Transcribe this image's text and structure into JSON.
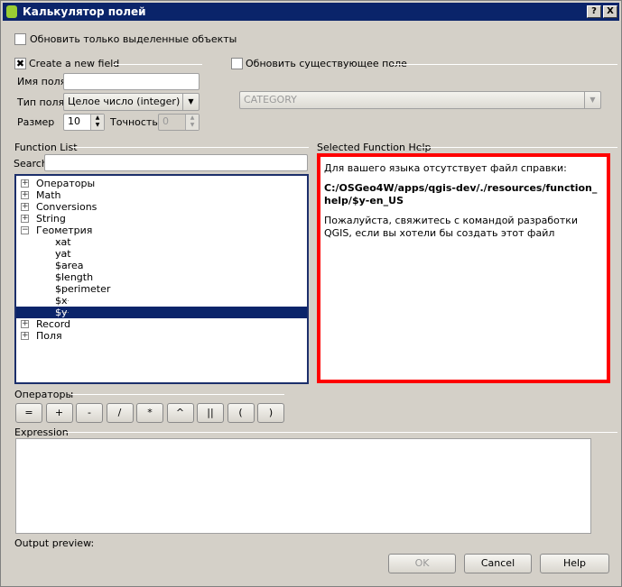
{
  "window": {
    "title": "Калькулятор полей",
    "help_btn": "?",
    "close_btn": "X"
  },
  "only_selected": {
    "label": "Обновить только выделенные объекты",
    "checked": false
  },
  "new_field": {
    "label": "Create a new field",
    "checked": true,
    "name_label": "Имя поля",
    "name_value": "",
    "type_label": "Тип поля",
    "type_value": "Целое число (integer)",
    "size_label": "Размер",
    "size_value": "10",
    "precision_label": "Точность",
    "precision_value": "0"
  },
  "update_existing": {
    "label": "Обновить существующее поле",
    "checked": false,
    "field_value": "CATEGORY"
  },
  "function_list": {
    "label": "Function List",
    "search_label": "Search",
    "search_value": "",
    "items": [
      {
        "label": "Операторы",
        "expanded": false
      },
      {
        "label": "Math",
        "expanded": false
      },
      {
        "label": "Conversions",
        "expanded": false
      },
      {
        "label": "String",
        "expanded": false
      },
      {
        "label": "Геометрия",
        "expanded": true,
        "children": [
          "xat",
          "yat",
          "$area",
          "$length",
          "$perimeter",
          "$x",
          "$y"
        ]
      },
      {
        "label": "Record",
        "expanded": false
      },
      {
        "label": "Поля",
        "expanded": false
      }
    ],
    "selected": "$y"
  },
  "help": {
    "label": "Selected Function Help",
    "line1": "Для вашего языка отсутствует файл справки:",
    "path": "C:/OSGeo4W/apps/qgis-dev/./resources/function_help/$y-en_US",
    "line2": "Пожалуйста, свяжитесь с командой разработки QGIS, если вы хотели бы создать этот файл",
    "border_color": "#ff0000"
  },
  "operators": {
    "label": "Операторы",
    "buttons": [
      "=",
      "+",
      "-",
      "/",
      "*",
      "^",
      "||",
      "(",
      ")"
    ]
  },
  "expression": {
    "label": "Expression",
    "value": ""
  },
  "output_preview": {
    "label": "Output preview:"
  },
  "buttons": {
    "ok": "OK",
    "cancel": "Cancel",
    "help": "Help"
  }
}
